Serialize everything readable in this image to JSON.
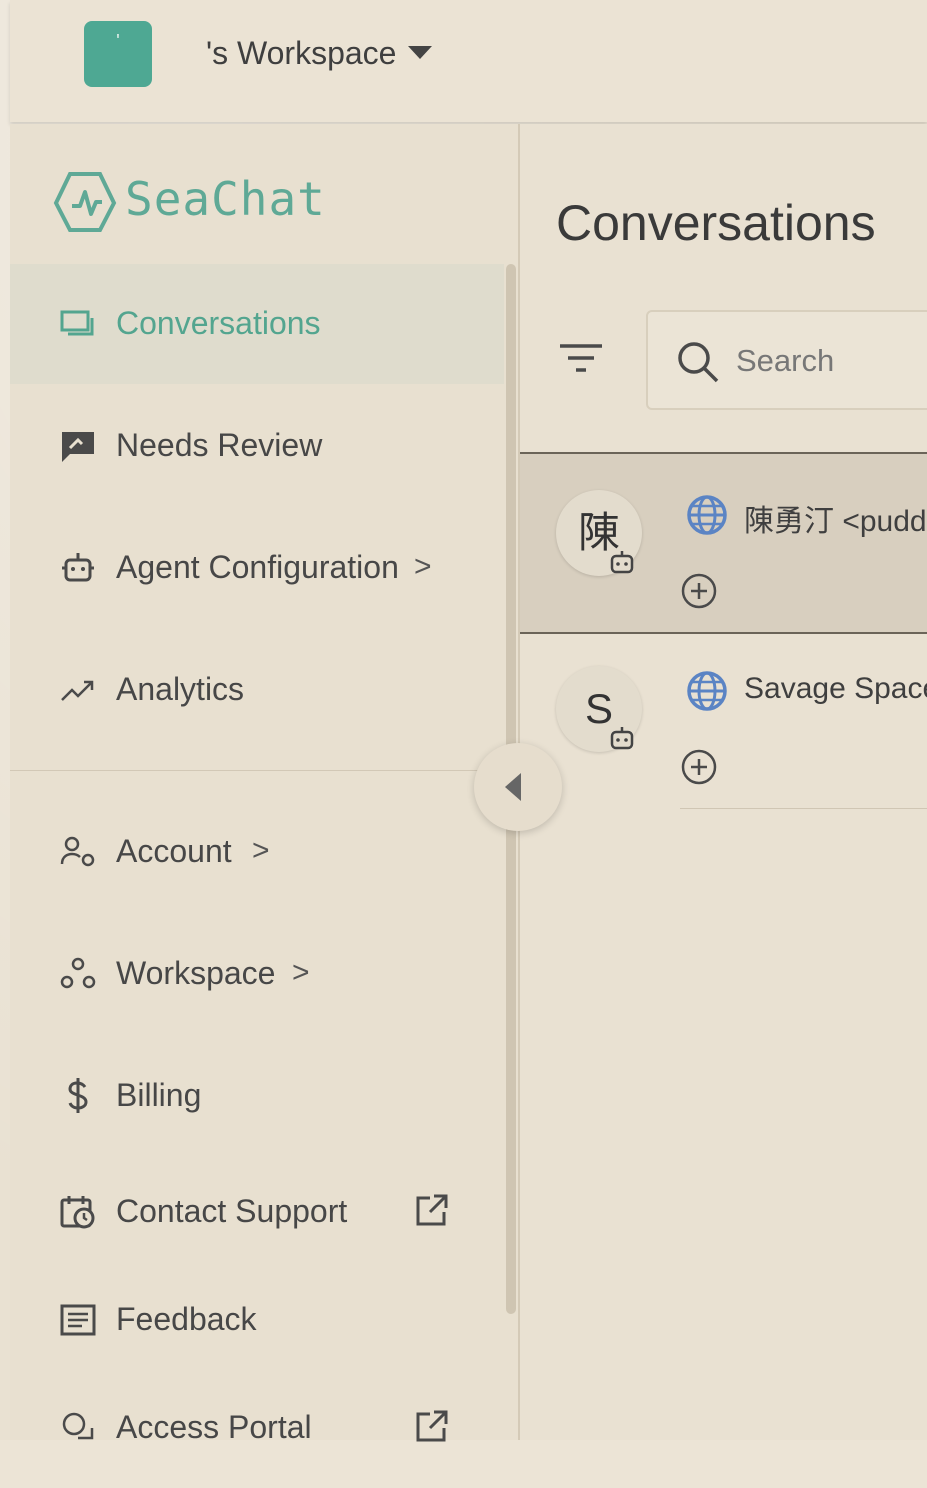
{
  "workspace": {
    "avatar_letter": "'",
    "name": "'s Workspace"
  },
  "brand": {
    "name": "SeaChat",
    "accent": "#53a58f"
  },
  "sidebar": {
    "items": [
      {
        "label": "Conversations",
        "icon": "chat-icon",
        "active": true
      },
      {
        "label": "Needs Review",
        "icon": "review-icon"
      },
      {
        "label": "Agent Configuration",
        "icon": "robot-icon",
        "chevron": ">"
      },
      {
        "label": "Analytics",
        "icon": "trend-icon"
      },
      {
        "label": "Account",
        "icon": "account-settings-icon",
        "chevron": ">"
      },
      {
        "label": "Workspace",
        "icon": "workspace-icon",
        "chevron": ">"
      },
      {
        "label": "Billing",
        "icon": "dollar-icon"
      },
      {
        "label": "Contact Support",
        "icon": "calendar-clock-icon",
        "external": true
      },
      {
        "label": "Feedback",
        "icon": "feedback-icon"
      },
      {
        "label": "Access Portal",
        "icon": "portal-icon",
        "external": true
      }
    ]
  },
  "main": {
    "title": "Conversations",
    "search": {
      "placeholder": "Search"
    },
    "conversations": [
      {
        "avatar": "陳",
        "name": "陳勇汀 <pudd",
        "channel_icon": "globe-icon",
        "selected": true
      },
      {
        "avatar": "S",
        "name": "Savage Space",
        "channel_icon": "globe-icon",
        "selected": false
      }
    ]
  }
}
